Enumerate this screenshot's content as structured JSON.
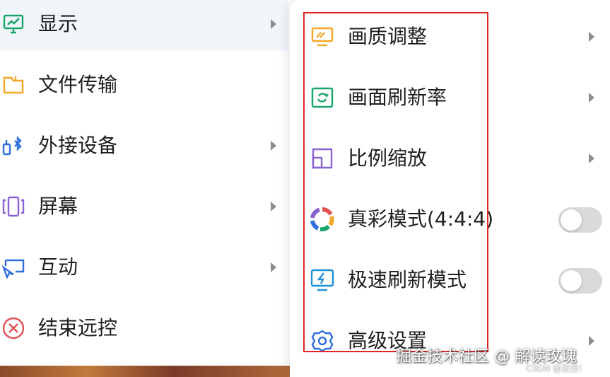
{
  "left_menu": {
    "items": [
      {
        "label": "显示",
        "icon": "monitor-chart-icon",
        "color": "#1aa56a",
        "has_arrow": true,
        "active": true
      },
      {
        "label": "文件传输",
        "icon": "folder-icon",
        "color": "#f5a623",
        "has_arrow": false
      },
      {
        "label": "外接设备",
        "icon": "bluetooth-device-icon",
        "color": "#2f6fdc",
        "has_arrow": true
      },
      {
        "label": "屏幕",
        "icon": "screens-icon",
        "color": "#8a63d2",
        "has_arrow": true
      },
      {
        "label": "互动",
        "icon": "interaction-icon",
        "color": "#2f6fdc",
        "has_arrow": true
      },
      {
        "label": "结束远控",
        "icon": "close-circle-icon",
        "color": "#e05252",
        "has_arrow": false
      }
    ]
  },
  "submenu": {
    "items": [
      {
        "label": "画质调整",
        "icon": "picture-quality-icon",
        "color": "#f5a623",
        "control": "arrow"
      },
      {
        "label": "画面刷新率",
        "icon": "refresh-rate-icon",
        "color": "#1aa56a",
        "control": "arrow"
      },
      {
        "label": "比例缩放",
        "icon": "scale-icon",
        "color": "#8a63d2",
        "control": "arrow"
      },
      {
        "label": "真彩模式(4:4:4)",
        "icon": "true-color-icon",
        "color": "#e05252",
        "control": "toggle",
        "toggle_on": false
      },
      {
        "label": "极速刷新模式",
        "icon": "fast-refresh-icon",
        "color": "#1e90d8",
        "control": "toggle",
        "toggle_on": false
      },
      {
        "label": "高级设置",
        "icon": "gear-icon",
        "color": "#2f6fdc",
        "control": "arrow"
      }
    ]
  },
  "annotation": {
    "highlight_color": "#e02424"
  },
  "watermark": {
    "text": "掘金技术社区 @ 解读玫瑰",
    "sub": "CSDN @浩浩！"
  }
}
